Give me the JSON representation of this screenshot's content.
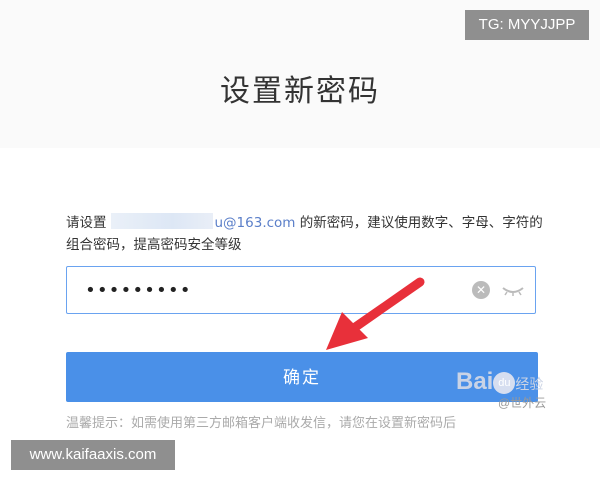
{
  "page": {
    "title": "设置新密码",
    "instruction_prefix": "请设置",
    "email_domain": "u@163.com",
    "instruction_suffix": " 的新密码，建议使用数字、字母、字符的组合密码，提高密码安全等级"
  },
  "password_field": {
    "value": "•••••••••"
  },
  "confirm_button": {
    "label": "确定"
  },
  "tip": {
    "text": "温馨提示：如需使用第三方邮箱客户端收发信，请您在设置新密码后"
  },
  "overlays": {
    "tg_badge": "TG: MYYJJPP",
    "site_badge": "www.kaifaaxis.com",
    "baidu_brand": "Bai",
    "baidu_paw": "du",
    "baidu_suffix": "经验",
    "baidu_author": "@世外云"
  },
  "colors": {
    "accent": "#4a90e8",
    "field_border": "#6aa3f0",
    "arrow": "#e8303a"
  }
}
